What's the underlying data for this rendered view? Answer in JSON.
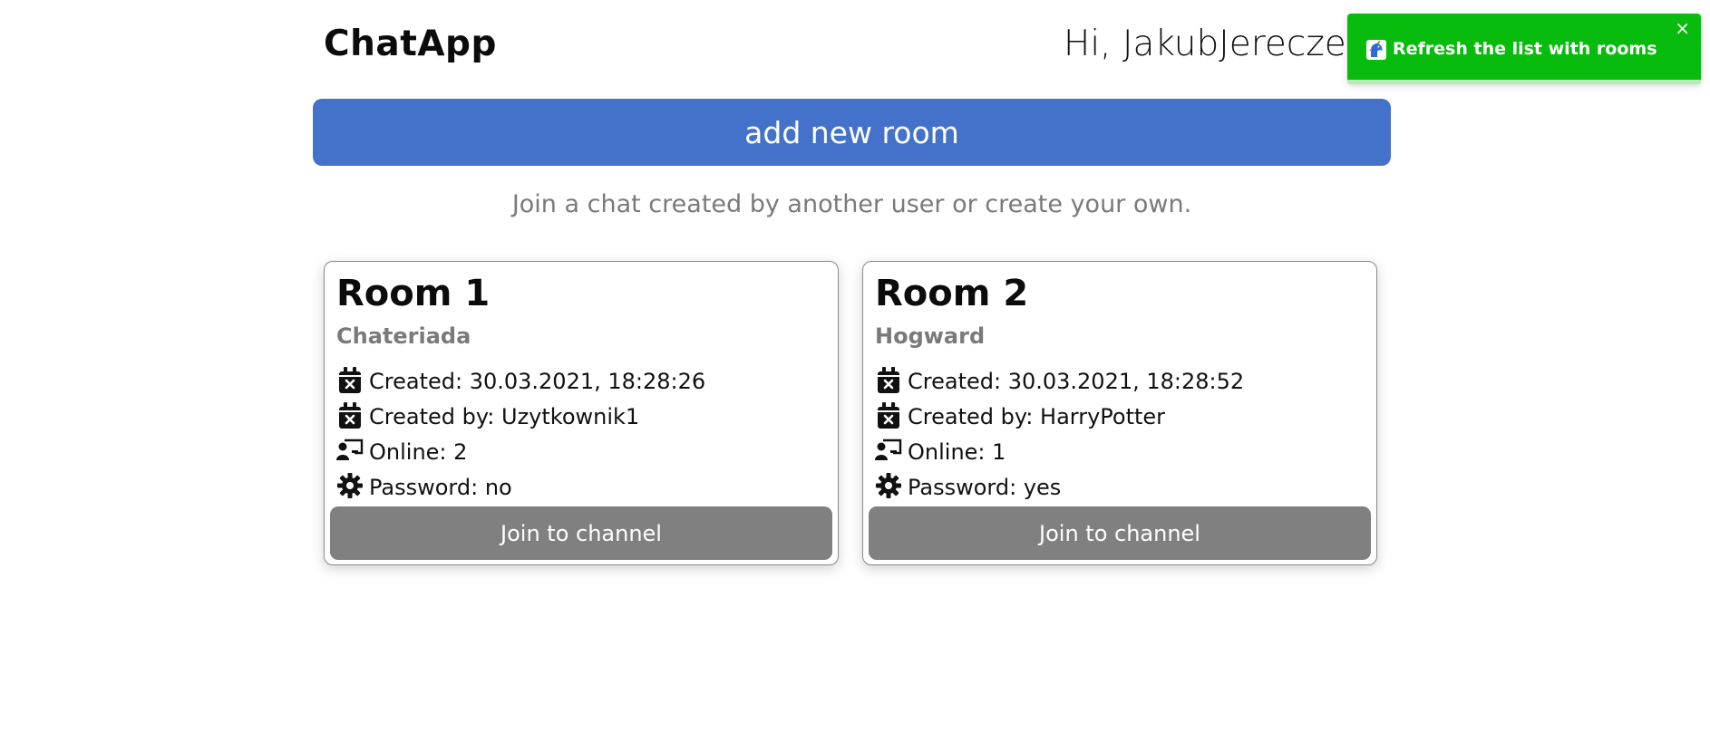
{
  "header": {
    "brand": "ChatApp",
    "greeting": "Hi, JakubJereczek"
  },
  "actions": {
    "add_room_label": "add new room"
  },
  "subtitle": "Join a chat created by another user or create your own.",
  "rooms": [
    {
      "title": "Room 1",
      "name": "Chateriada",
      "created": "Created: 30.03.2021, 18:28:26",
      "created_by": "Created by: Uzytkownik1",
      "online": "Online: 2",
      "password": "Password: no",
      "join_label": "Join to channel"
    },
    {
      "title": "Room 2",
      "name": "Hogward",
      "created": "Created: 30.03.2021, 18:28:52",
      "created_by": "Created by: HarryPotter",
      "online": "Online: 1",
      "password": "Password: yes",
      "join_label": "Join to channel"
    }
  ],
  "toast": {
    "message": "Refresh the list with rooms",
    "close_symbol": "×",
    "progress": 1.0,
    "icon": "unicorn-icon"
  },
  "colors": {
    "primary": "#4472ca",
    "join_button": "#808080",
    "toast_success": "#07bc0c",
    "muted_text": "#7a7a7a"
  },
  "icons": {
    "created": "calendar-x-icon",
    "created_by": "calendar-x-icon",
    "online": "chalkboard-user-icon",
    "password": "gear-icon"
  }
}
